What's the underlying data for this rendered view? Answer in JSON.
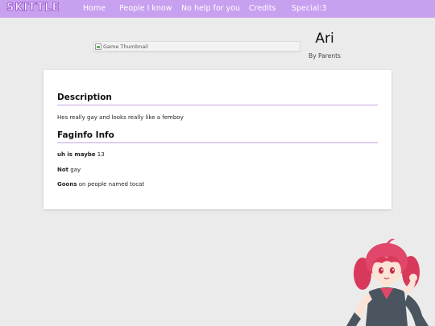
{
  "nav": {
    "logo": "SKITTLE",
    "links": [
      "Home",
      "People I know",
      "No help for you",
      "Credits",
      "Special:3"
    ]
  },
  "game": {
    "thumbnail_alt": "Game Thumbnail",
    "title": "Ari",
    "author": "By Parents"
  },
  "description": {
    "heading": "Description",
    "text": "Hes really gay and looks really like a femboy"
  },
  "info": {
    "heading": "Faginfo Info",
    "rows": [
      {
        "label": "uh is maybe",
        "value": "13"
      },
      {
        "label": "Not",
        "value": "gay"
      },
      {
        "label": "Goons",
        "value": "on people named tocat"
      }
    ]
  },
  "colors": {
    "navbar": "#c8a0f0",
    "accent_rule": "#c5a2e6",
    "background": "#ebebeb"
  },
  "icons": {
    "broken_image": "broken-image-icon",
    "mascot": "anime-mascot-illustration"
  }
}
